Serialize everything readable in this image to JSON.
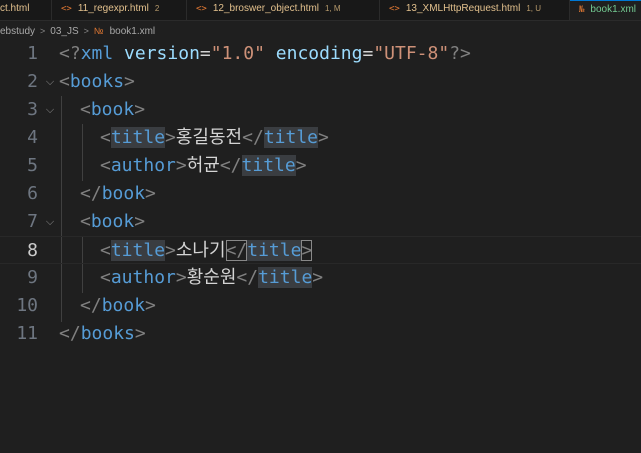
{
  "tabs": [
    {
      "name": "ct.html",
      "icon": "",
      "badge": ""
    },
    {
      "name": "11_regexpr.html",
      "icon": "<>",
      "badge": "2"
    },
    {
      "name": "12_broswer_object.html",
      "icon": "<>",
      "badge": "1, M"
    },
    {
      "name": "13_XMLHttpRequest.html",
      "icon": "<>",
      "badge": "1, U"
    },
    {
      "name": "book1.xml",
      "icon": "rss",
      "badge": ""
    }
  ],
  "breadcrumb": {
    "part1": "ebstudy",
    "sep": ">",
    "part2": "03_JS",
    "file": "book1.xml"
  },
  "editor": {
    "line_numbers": [
      "1",
      "2",
      "3",
      "4",
      "5",
      "6",
      "7",
      "8",
      "9",
      "10",
      "11"
    ],
    "current_line": 8,
    "xml_decl": {
      "open": "<?",
      "name": "xml",
      "attr1": "version",
      "eq": "=",
      "val1": "\"1.0\"",
      "attr2": "encoding",
      "val2": "\"UTF-8\"",
      "close": "?>"
    },
    "tags": {
      "books": "books",
      "book": "book",
      "title": "title",
      "author": "author"
    },
    "text": {
      "book1_title": "홍길동전",
      "book1_author": "허균",
      "book2_title": "소나기",
      "book2_author": "황순원"
    },
    "punct": {
      "lt": "<",
      "gt": ">",
      "lts": "</"
    }
  }
}
